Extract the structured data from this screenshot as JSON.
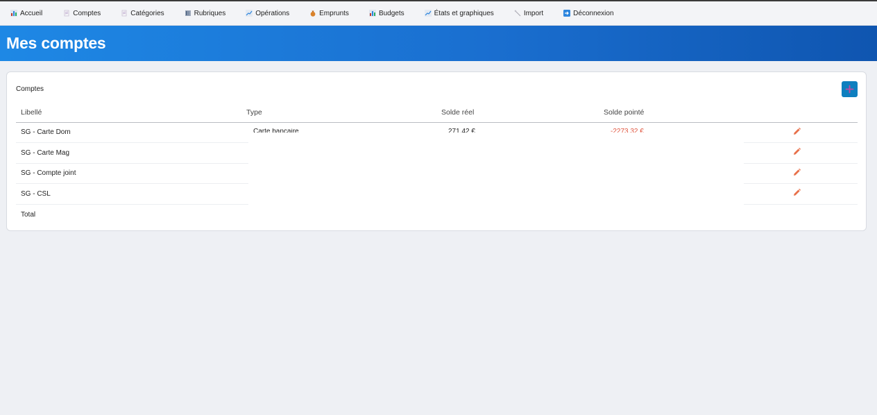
{
  "nav": {
    "items": [
      {
        "label": "Accueil",
        "icon": "bar-chart-icon"
      },
      {
        "label": "Comptes",
        "icon": "document-icon"
      },
      {
        "label": "Catégories",
        "icon": "document-icon"
      },
      {
        "label": "Rubriques",
        "icon": "folder-icon"
      },
      {
        "label": "Opérations",
        "icon": "line-chart-icon"
      },
      {
        "label": "Emprunts",
        "icon": "money-bag-icon"
      },
      {
        "label": "Budgets",
        "icon": "bar-chart-icon"
      },
      {
        "label": "États et graphiques",
        "icon": "line-chart-icon"
      },
      {
        "label": "Import",
        "icon": "pin-icon"
      },
      {
        "label": "Déconnexion",
        "icon": "logout-icon"
      }
    ]
  },
  "page": {
    "title": "Mes comptes"
  },
  "card": {
    "title": "Comptes",
    "add_button": "+"
  },
  "table": {
    "columns": [
      "Libellé",
      "Type",
      "Solde réel",
      "Solde pointé"
    ],
    "rows": [
      {
        "libelle": "SG - Carte Dom"
      },
      {
        "libelle": "SG - Carte Mag"
      },
      {
        "libelle": "SG - Compte joint"
      },
      {
        "libelle": "SG - CSL"
      }
    ],
    "total_label": "Total",
    "first_row_clipped": {
      "type": "Carte bancaire",
      "solde_reel": "271,42 €",
      "solde_pointe": "-2273,32 €"
    }
  },
  "colors": {
    "accent": "#1e88e5",
    "banner_end": "#0f55b0",
    "add_button": "#0e7fbf",
    "edit_icon": "#e8704a",
    "negative": "#e0553e"
  }
}
